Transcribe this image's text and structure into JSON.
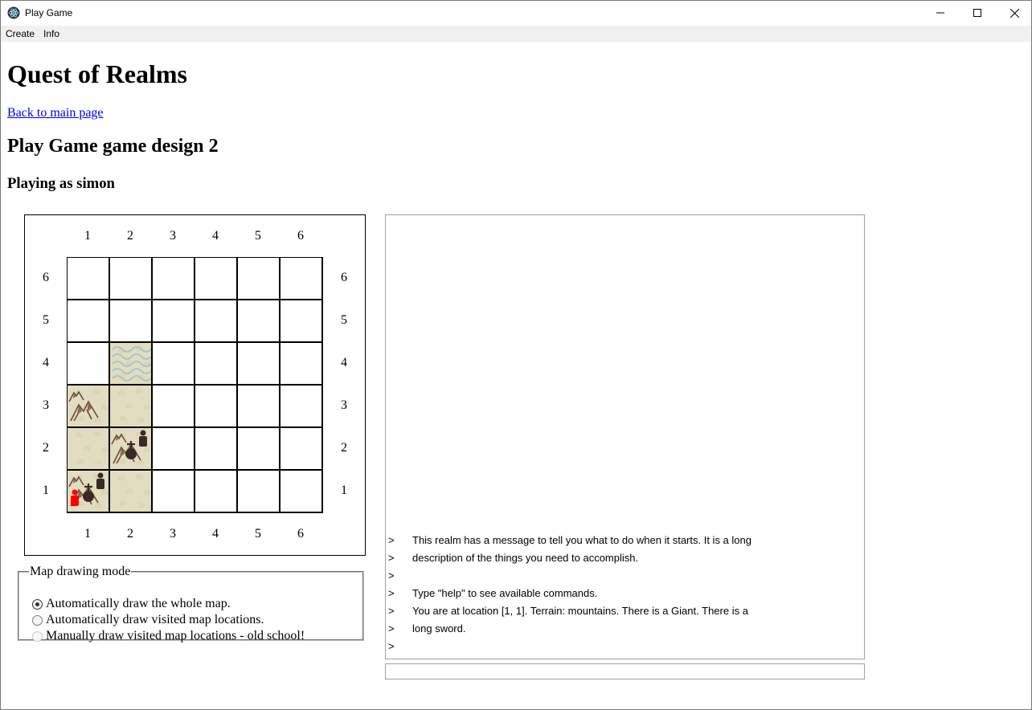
{
  "window": {
    "title": "Play Game"
  },
  "menu": {
    "items": [
      "Create",
      "Info"
    ]
  },
  "page": {
    "title": "Quest of Realms",
    "back_link": "Back to main page",
    "game_title": "Play Game game design 2",
    "player_line": "Playing as simon"
  },
  "map": {
    "columns": [
      "1",
      "2",
      "3",
      "4",
      "5",
      "6"
    ],
    "rows": [
      "6",
      "5",
      "4",
      "3",
      "2",
      "1"
    ],
    "cells": [
      {
        "x": 2,
        "y": 4,
        "terrain": "water",
        "items": []
      },
      {
        "x": 1,
        "y": 3,
        "terrain": "mountains",
        "items": []
      },
      {
        "x": 2,
        "y": 3,
        "terrain": "plains",
        "items": []
      },
      {
        "x": 1,
        "y": 2,
        "terrain": "plains",
        "items": []
      },
      {
        "x": 2,
        "y": 2,
        "terrain": "mountains",
        "items": [
          "character-icon",
          "sword-icon"
        ]
      },
      {
        "x": 1,
        "y": 1,
        "terrain": "mountains",
        "items": [
          "player-icon",
          "character-icon",
          "sword-icon"
        ]
      },
      {
        "x": 2,
        "y": 1,
        "terrain": "plains",
        "items": []
      }
    ],
    "colors": {
      "terrain_bg": "#e2dcc0",
      "player": "#ff0000",
      "character": "#3a2a26"
    }
  },
  "map_mode": {
    "legend": "Map drawing mode",
    "options": [
      {
        "label": "Automatically draw the whole map.",
        "checked": true,
        "disabled": false
      },
      {
        "label": "Automatically draw visited map locations.",
        "checked": false,
        "disabled": false
      },
      {
        "label": "Manually draw visited map locations - old school!",
        "checked": false,
        "disabled": true
      }
    ]
  },
  "console": {
    "prompt": ">",
    "lines": [
      "This realm has a message to tell you what to do when it starts. It is a long",
      "description of the things you need to accomplish.",
      "",
      "Type \"help\" to see available commands.",
      "You are at location [1, 1]. Terrain: mountains. There is a Giant.  There is a",
      "long sword.",
      ""
    ],
    "input_value": ""
  }
}
